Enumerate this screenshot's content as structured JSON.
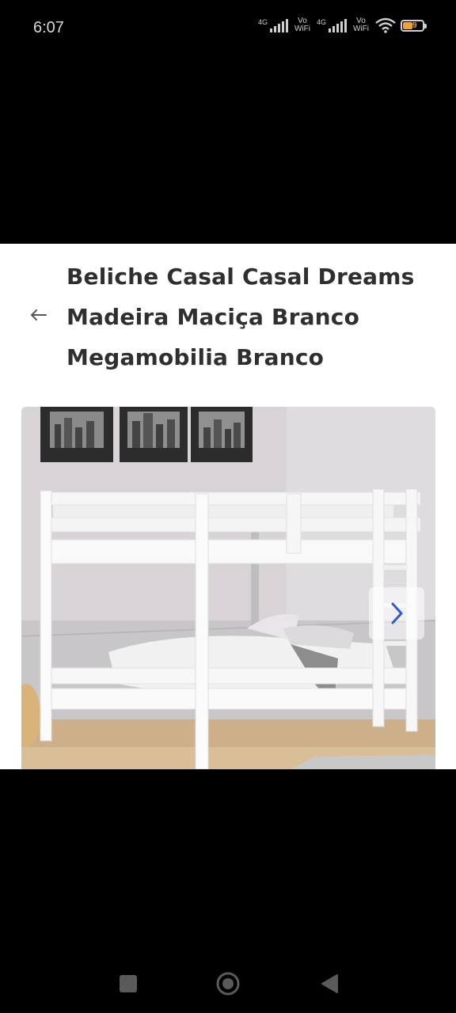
{
  "status_bar": {
    "time": "6:07",
    "sim1_tag": "4G",
    "sim2_tag": "4G",
    "volte_wifi_label_1": "Vo WiFi",
    "volte_wifi_label_2": "Vo WiFi",
    "battery_level": "49",
    "battery_color": "#e7a33e"
  },
  "header": {
    "back_icon": "arrow-left-icon",
    "title_lines": [
      "Beliche Casal Casal Dreams",
      "Madeira Maciça Branco",
      "Megamobilia Branco"
    ]
  },
  "carousel": {
    "image_alt": "Beliche Casal Casal Dreams Madeira Maciça Branco Megamobilia Branco",
    "next_icon": "chevron-right-icon",
    "next_icon_color": "#2b5cc8"
  },
  "nav_bar": {
    "recents_icon": "square-icon",
    "home_icon": "circle-icon",
    "back_icon": "triangle-back-icon"
  }
}
